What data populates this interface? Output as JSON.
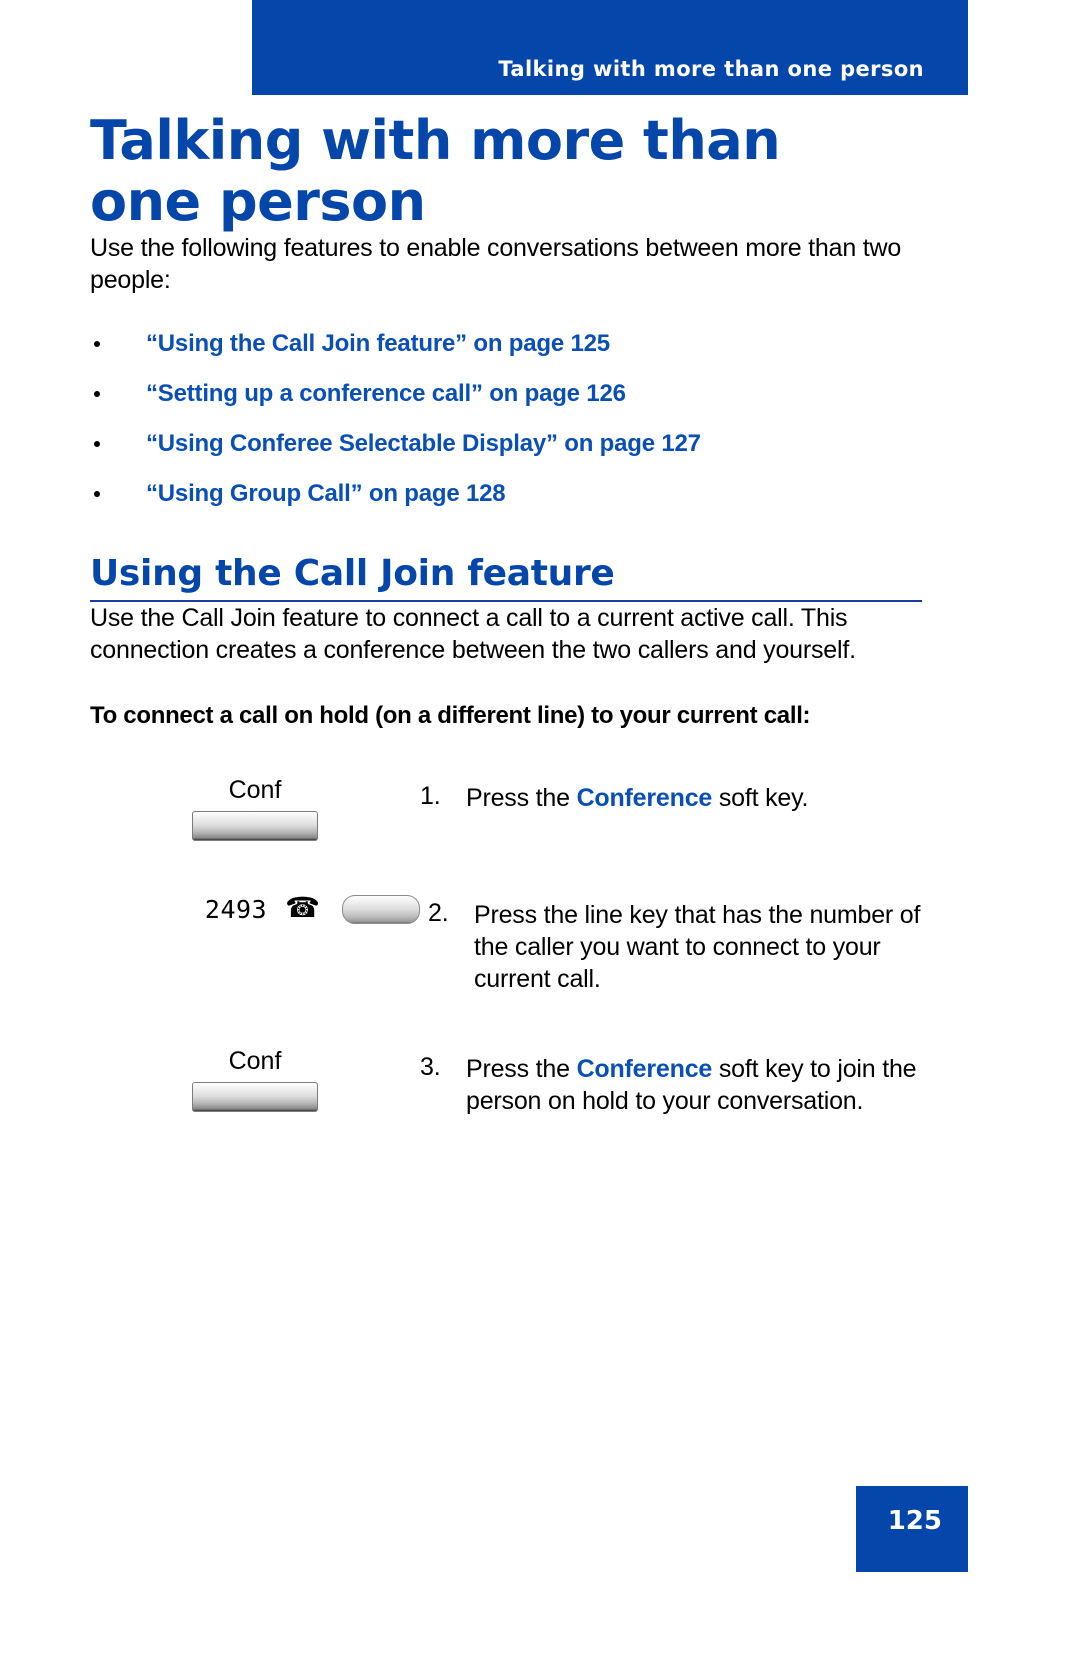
{
  "header": {
    "running_title": "Talking with more than one person"
  },
  "page_title": "Talking with more than one person",
  "intro_paragraph": "Use the following features to enable conversations between more than two people:",
  "cross_references": [
    {
      "text": "“Using the Call Join feature” on page 125"
    },
    {
      "text": "“Setting up a conference call” on page 126"
    },
    {
      "text": "“Using Conferee Selectable Display” on page 127"
    },
    {
      "text": "“Using Group Call” on page 128"
    }
  ],
  "section": {
    "heading": "Using the Call Join feature",
    "paragraph": "Use the Call Join feature to connect a call to a current active call. This connection creates a conference between the two callers and yourself.",
    "lead_in": "To connect a call on hold (on a different line) to your current call:"
  },
  "steps": [
    {
      "number": "1.",
      "figure_type": "softkey",
      "figure_label": "Conf",
      "text_before": "Press the ",
      "keyword": "Conference",
      "text_after": " soft key."
    },
    {
      "number": "2.",
      "figure_type": "linekey",
      "line_number": "2493",
      "phone_icon": "telephone-icon",
      "text_before": "Press the line key that has the number of the caller you want to connect to your current call.",
      "keyword": "",
      "text_after": ""
    },
    {
      "number": "3.",
      "figure_type": "softkey",
      "figure_label": "Conf",
      "text_before": "Press the ",
      "keyword": "Conference",
      "text_after": " soft key to join the person on hold to your conversation."
    }
  ],
  "footer": {
    "page_number": "125"
  },
  "colors": {
    "brand_blue": "#0546ab",
    "link_blue": "#0a4fb5",
    "rule_blue": "#1a3f9e",
    "text_black": "#000000"
  }
}
